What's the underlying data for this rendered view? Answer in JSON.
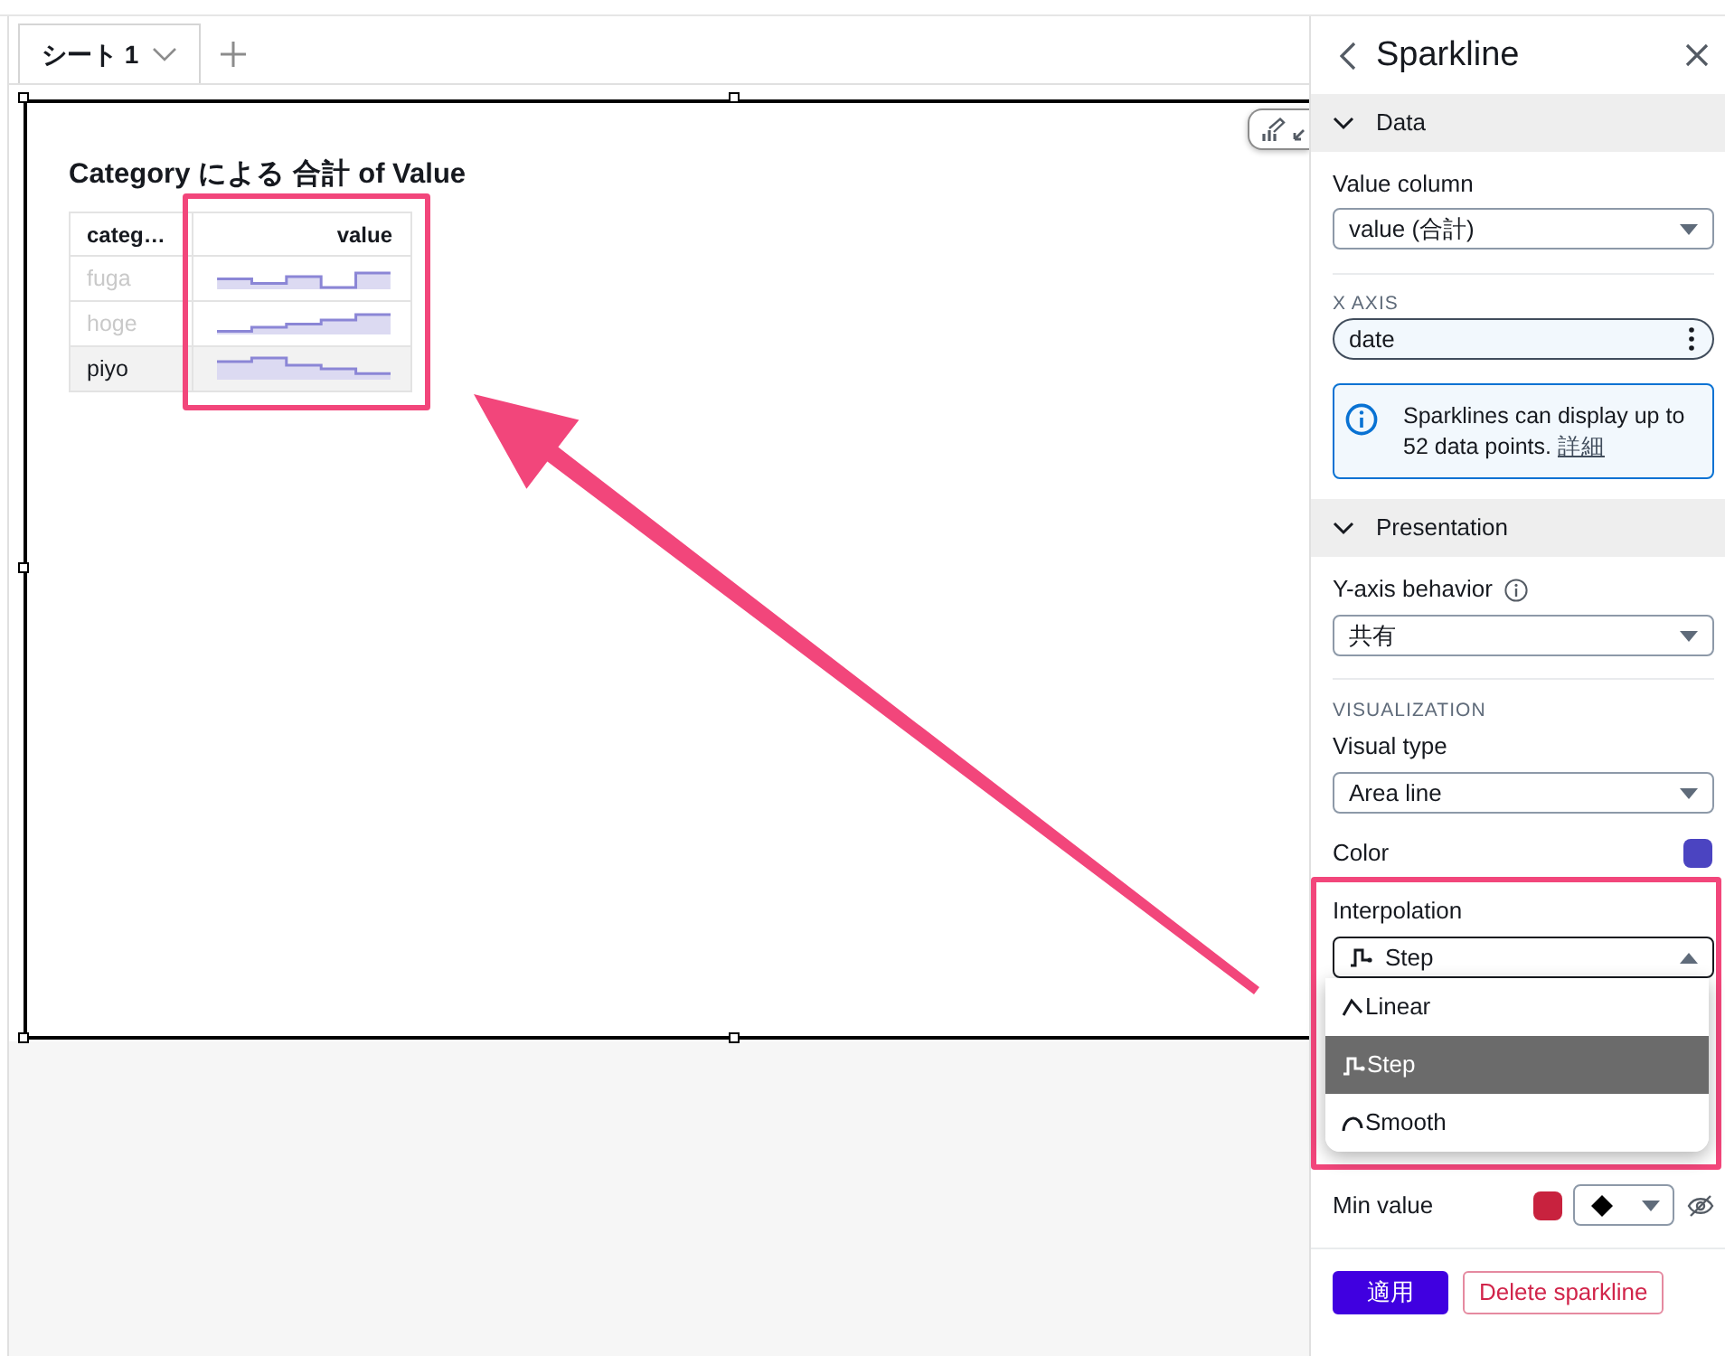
{
  "sheet_tabs": [
    {
      "label": "シート 1",
      "selected": true
    }
  ],
  "visual": {
    "title": "Category による 合計 of Value",
    "table": {
      "columns": [
        "categ…",
        "value"
      ],
      "rows": [
        {
          "category": "fuga",
          "selected": false
        },
        {
          "category": "hoge",
          "selected": false
        },
        {
          "category": "piyo",
          "selected": true
        }
      ]
    }
  },
  "panel": {
    "title": "Sparkline",
    "sections": [
      {
        "kind": "data",
        "title": "Data",
        "expanded": true,
        "value_column": {
          "label": "Value column",
          "value": "value (合計)"
        },
        "x_axis": {
          "label": "X AXIS",
          "field": "date"
        },
        "info": {
          "text": "Sparklines can display up to 52 data points.",
          "link": "詳細"
        }
      },
      {
        "kind": "presentation",
        "title": "Presentation",
        "expanded": true,
        "y_axis_behavior": {
          "label": "Y-axis behavior",
          "value": "共有"
        },
        "visualization": {
          "heading": "VISUALIZATION",
          "visual_type": {
            "label": "Visual type",
            "value": "Area line"
          },
          "color": {
            "label": "Color",
            "color": "#4b44c1"
          },
          "interpolation": {
            "label": "Interpolation",
            "value": "Step",
            "kind": "step",
            "expanded": true,
            "options": [
              {
                "label": "Linear",
                "kind": "linear",
                "selected": false
              },
              {
                "label": "Step",
                "kind": "step",
                "selected": true
              },
              {
                "label": "Smooth",
                "kind": "smooth",
                "selected": false
              }
            ]
          }
        },
        "min_value": {
          "label": "Min value",
          "color": "#c8223e",
          "marker": {
            "kind": "diamond"
          },
          "visible": false
        }
      }
    ],
    "buttons": [
      {
        "label": "適用",
        "kind": "primary"
      },
      {
        "label": "Delete sparkline",
        "kind": "danger"
      }
    ]
  }
}
